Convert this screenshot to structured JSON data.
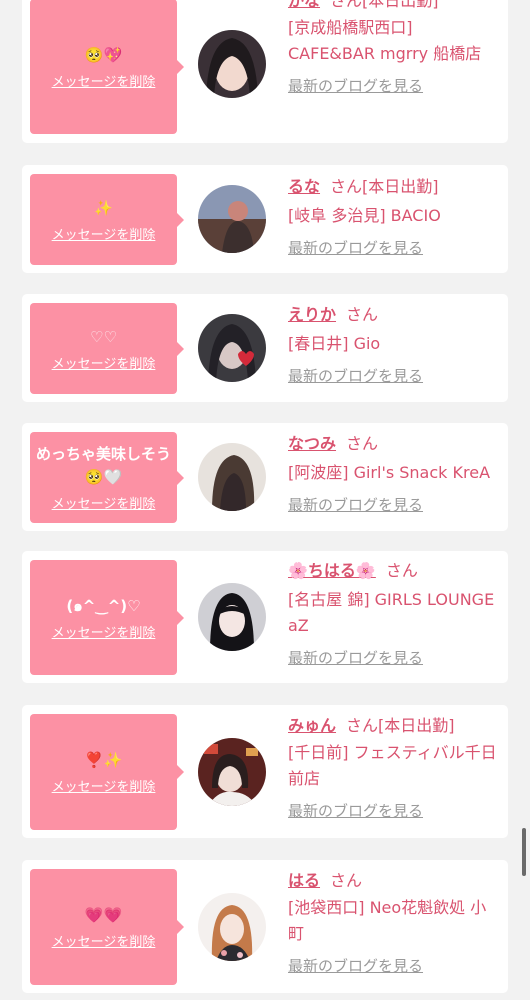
{
  "delete_label": "メッセージを削除",
  "san_label": "さん",
  "blog_label": "最新のブログを見る",
  "cards": [
    {
      "message": "🥺💖",
      "name": "かな",
      "status": "[本日出勤]",
      "store": "[京成船橋駅西口] CAFE&BAR mgrry 船橋店"
    },
    {
      "message": "✨",
      "name": "るな",
      "status": "[本日出勤]",
      "store": "[岐阜 多治見] BACIO"
    },
    {
      "message": "♡♡",
      "name": "えりか",
      "status": "",
      "store": "[春日井] Gio"
    },
    {
      "message": "めっちゃ美味しそう🥺🤍",
      "name": "なつみ",
      "status": "",
      "store": "[阿波座] Girl's Snack KreA"
    },
    {
      "message": "(๑^‿^)♡",
      "name": "🌸ちはる🌸",
      "status": "",
      "store": "[名古屋 錦] GIRLS LOUNGE aZ"
    },
    {
      "message": "❣️✨",
      "name": "みゅん",
      "status": "[本日出勤]",
      "store": "[千日前] フェスティバル千日前店"
    },
    {
      "message": "💗💗",
      "name": "はる",
      "status": "",
      "store": "[池袋西口] Neo花魁飲処 小町"
    }
  ]
}
